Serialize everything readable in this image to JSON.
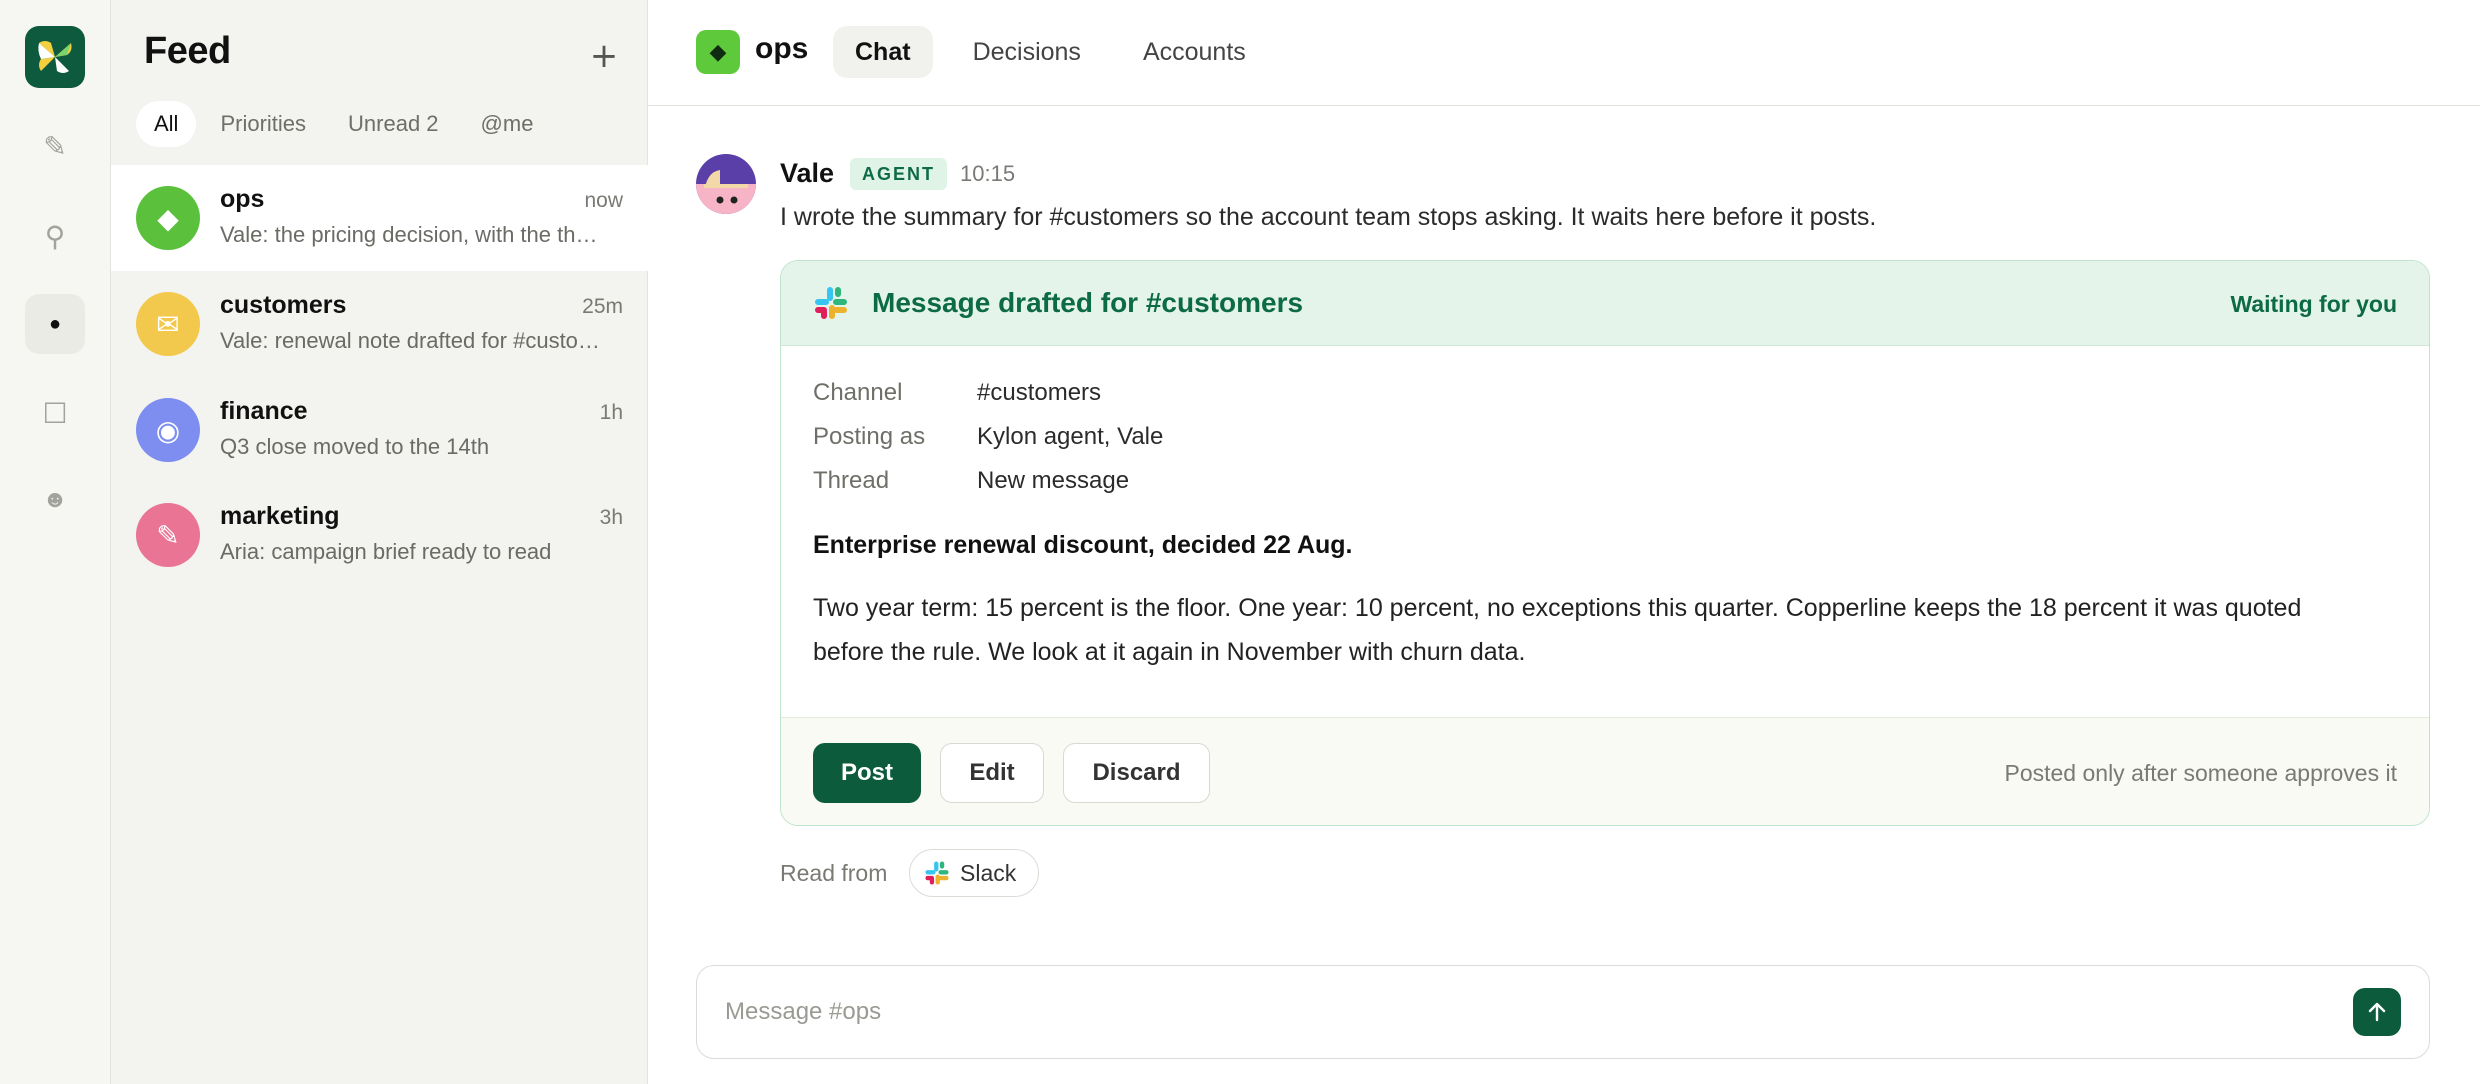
{
  "rail": {
    "items": [
      {
        "icon": "pencil-icon",
        "glyph": "✎"
      },
      {
        "icon": "pin-icon",
        "glyph": "⚲"
      },
      {
        "icon": "dot-icon",
        "glyph": "●"
      },
      {
        "icon": "square-icon",
        "glyph": "☐"
      },
      {
        "icon": "face-icon",
        "glyph": "☻"
      }
    ]
  },
  "feed": {
    "title": "Feed",
    "add_glyph": "+",
    "filters": [
      "All",
      "Priorities",
      "Unread 2",
      "@me"
    ],
    "conversations": [
      {
        "name": "ops",
        "time": "now",
        "preview": "Vale: the pricing decision, with the th…",
        "color": "#5bc13d",
        "glyph": "◆",
        "icon": "diamond-icon"
      },
      {
        "name": "customers",
        "time": "25m",
        "preview": "Vale: renewal note drafted for #custo…",
        "color": "#f2c94c",
        "glyph": "✉",
        "icon": "envelope-icon"
      },
      {
        "name": "finance",
        "time": "1h",
        "preview": "Q3 close moved to the 14th",
        "color": "#7d8ef0",
        "glyph": "◉",
        "icon": "target-icon"
      },
      {
        "name": "marketing",
        "time": "3h",
        "preview": "Aria: campaign brief ready to read",
        "color": "#ea7494",
        "glyph": "✎",
        "icon": "pencil-icon"
      }
    ]
  },
  "channel": {
    "name": "ops",
    "glyph": "◆",
    "tabs": [
      "Chat",
      "Decisions",
      "Accounts"
    ]
  },
  "message": {
    "author": "Vale",
    "badge": "AGENT",
    "time": "10:15",
    "text": "I wrote the summary for #customers so the account team stops asking. It waits here before it posts."
  },
  "draft": {
    "title": "Message drafted for #customers",
    "status": "Waiting for you",
    "meta": [
      {
        "label": "Channel",
        "value": "#customers"
      },
      {
        "label": "Posting as",
        "value": "Kylon agent, Vale"
      },
      {
        "label": "Thread",
        "value": "New message"
      }
    ],
    "heading": "Enterprise renewal discount, decided 22 Aug.",
    "body": "Two year term: 15 percent is the floor. One year: 10 percent, no exceptions this quarter. Copperline keeps the 18 percent it was quoted before the rule. We look at it again in November with churn data.",
    "actions": {
      "post": "Post",
      "edit": "Edit",
      "discard": "Discard"
    },
    "note": "Posted only after someone approves it"
  },
  "source": {
    "label": "Read from",
    "name": "Slack"
  },
  "composer": {
    "placeholder": "Message #ops"
  },
  "colors": {
    "brand": "#0c5b3d",
    "accent_light": "#e4f4ea",
    "accent_text": "#0c6a44"
  }
}
